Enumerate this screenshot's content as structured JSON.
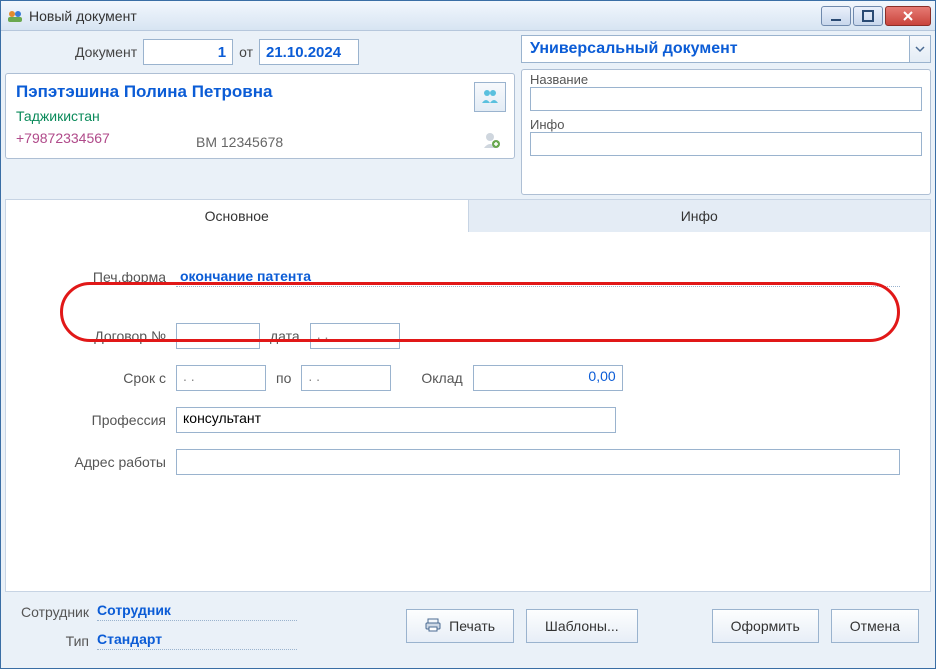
{
  "window": {
    "title": "Новый документ"
  },
  "doc": {
    "label": "Документ",
    "number": "1",
    "from_label": "от",
    "date": "21.10.2024"
  },
  "doc_type": {
    "selected": "Универсальный документ"
  },
  "meta": {
    "name_label": "Название",
    "name_value": "",
    "info_label": "Инфо",
    "info_value": ""
  },
  "person": {
    "full_name": "Пэпэтэшина Полина Петровна",
    "country": "Таджикистан",
    "phone": "+79872334567",
    "id_number": "BM 12345678"
  },
  "tabs": {
    "main": "Основное",
    "info": "Инфо"
  },
  "form": {
    "print_form_label": "Печ.форма",
    "print_form_value": "окончание патента",
    "contract_label": "Договор №",
    "contract_number": "",
    "contract_date_label": "дата",
    "contract_date": ".  .",
    "period_label": "Срок с",
    "period_from": ".  .",
    "period_to_label": "по",
    "period_to": ".  .",
    "salary_label": "Оклад",
    "salary_value": "0,00",
    "profession_label": "Профессия",
    "profession_value": "консультант",
    "work_address_label": "Адрес работы",
    "work_address_value": ""
  },
  "footer": {
    "employee_label": "Сотрудник",
    "employee_value": "Сотрудник",
    "type_label": "Тип",
    "type_value": "Стандарт",
    "print": "Печать",
    "templates": "Шаблоны...",
    "confirm": "Оформить",
    "cancel": "Отмена"
  }
}
